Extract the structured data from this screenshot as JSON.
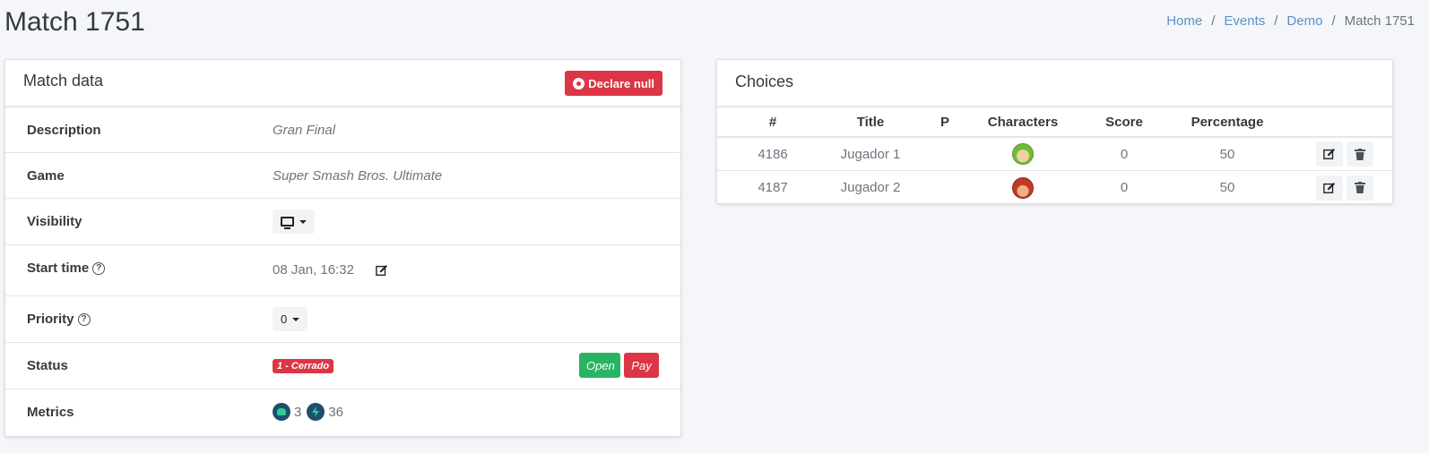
{
  "header": {
    "title": "Match 1751",
    "breadcrumb": [
      "Home",
      "Events",
      "Demo"
    ],
    "breadcrumb_current": "Match 1751",
    "breadcrumb_sep": "/"
  },
  "match_card": {
    "title": "Match data",
    "declare_null_label": "Declare null",
    "rows": {
      "description": {
        "label": "Description",
        "value": "Gran Final"
      },
      "game": {
        "label": "Game",
        "value": "Super Smash Bros. Ultimate"
      },
      "visibility": {
        "label": "Visibility",
        "icon": "monitor-icon"
      },
      "start_time": {
        "label": "Start time",
        "value": "08 Jan, 16:32",
        "help": "?"
      },
      "priority": {
        "label": "Priority",
        "value": "0",
        "help": "?"
      },
      "status": {
        "label": "Status",
        "badge": "1 - Cerrado",
        "open_label": "Open",
        "pay_label": "Pay"
      },
      "metrics": {
        "label": "Metrics",
        "users": "3",
        "bolts": "36"
      }
    }
  },
  "choices_card": {
    "title": "Choices",
    "columns": [
      "#",
      "Title",
      "P",
      "Characters",
      "Score",
      "Percentage"
    ],
    "rows": [
      {
        "id": "4186",
        "title": "Jugador 1",
        "p": "",
        "character": "link-icon",
        "score": "0",
        "percentage": "50"
      },
      {
        "id": "4187",
        "title": "Jugador 2",
        "p": "",
        "character": "captain-falcon-icon",
        "score": "0",
        "percentage": "50"
      }
    ]
  },
  "colors": {
    "danger": "#dc3545",
    "success": "#28b463",
    "link": "#5d91c7",
    "background": "#f4f6f9"
  }
}
